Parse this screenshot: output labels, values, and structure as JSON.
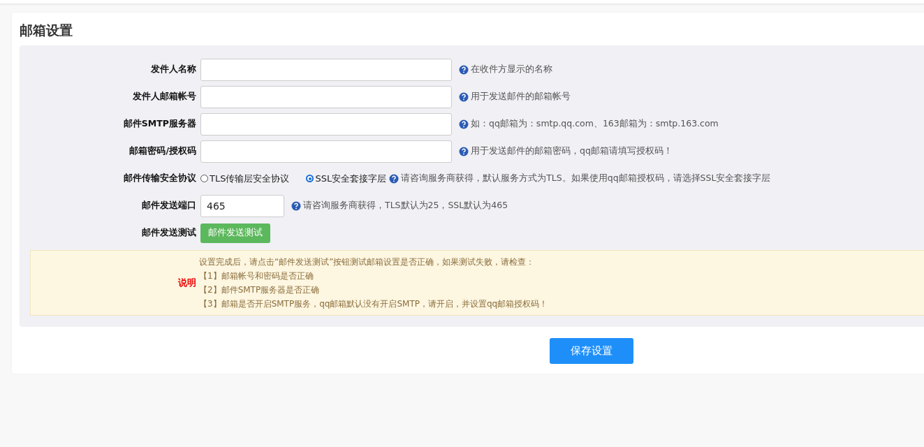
{
  "title": "邮箱设置",
  "rows": [
    {
      "kind": "text",
      "label": "发件人名称",
      "value": "",
      "hint": "在收件方显示的名称"
    },
    {
      "kind": "text",
      "label": "发件人邮箱帐号",
      "value": "",
      "hint": "用于发送邮件的邮箱帐号"
    },
    {
      "kind": "text",
      "label": "邮件SMTP服务器",
      "value": "",
      "hint": "如：qq邮箱为：smtp.qq.com、163邮箱为：smtp.163.com"
    },
    {
      "kind": "text",
      "label": "邮箱密码/授权码",
      "value": "",
      "hint": "用于发送邮件的邮箱密码，qq邮箱请填写授权码！"
    },
    {
      "kind": "radio",
      "label": "邮件传输安全协议",
      "options": [
        {
          "label": "TLS传输层安全协议",
          "selected": false
        },
        {
          "label": "SSL安全套接字层",
          "selected": true
        }
      ],
      "hint": "请咨询服务商获得，默认服务方式为TLS。如果使用qq邮箱授权码，请选择SSL安全套接字层"
    },
    {
      "kind": "short",
      "label": "邮件发送端口",
      "value": "465",
      "hint": "请咨询服务商获得，TLS默认为25，SSL默认为465"
    },
    {
      "kind": "button",
      "label": "邮件发送测试",
      "button": "邮件发送测试"
    }
  ],
  "note": {
    "label": "说明",
    "lines": [
      "设置完成后，请点击“邮件发送测试”按钮测试邮箱设置是否正确，如果测试失败，请检查：",
      "【1】邮箱帐号和密码是否正确",
      "【2】邮件SMTP服务器是否正确",
      "【3】邮箱是否开启SMTP服务，qq邮箱默认没有开启SMTP，请开启，并设置qq邮箱授权码！"
    ]
  },
  "save_button": "保存设置"
}
